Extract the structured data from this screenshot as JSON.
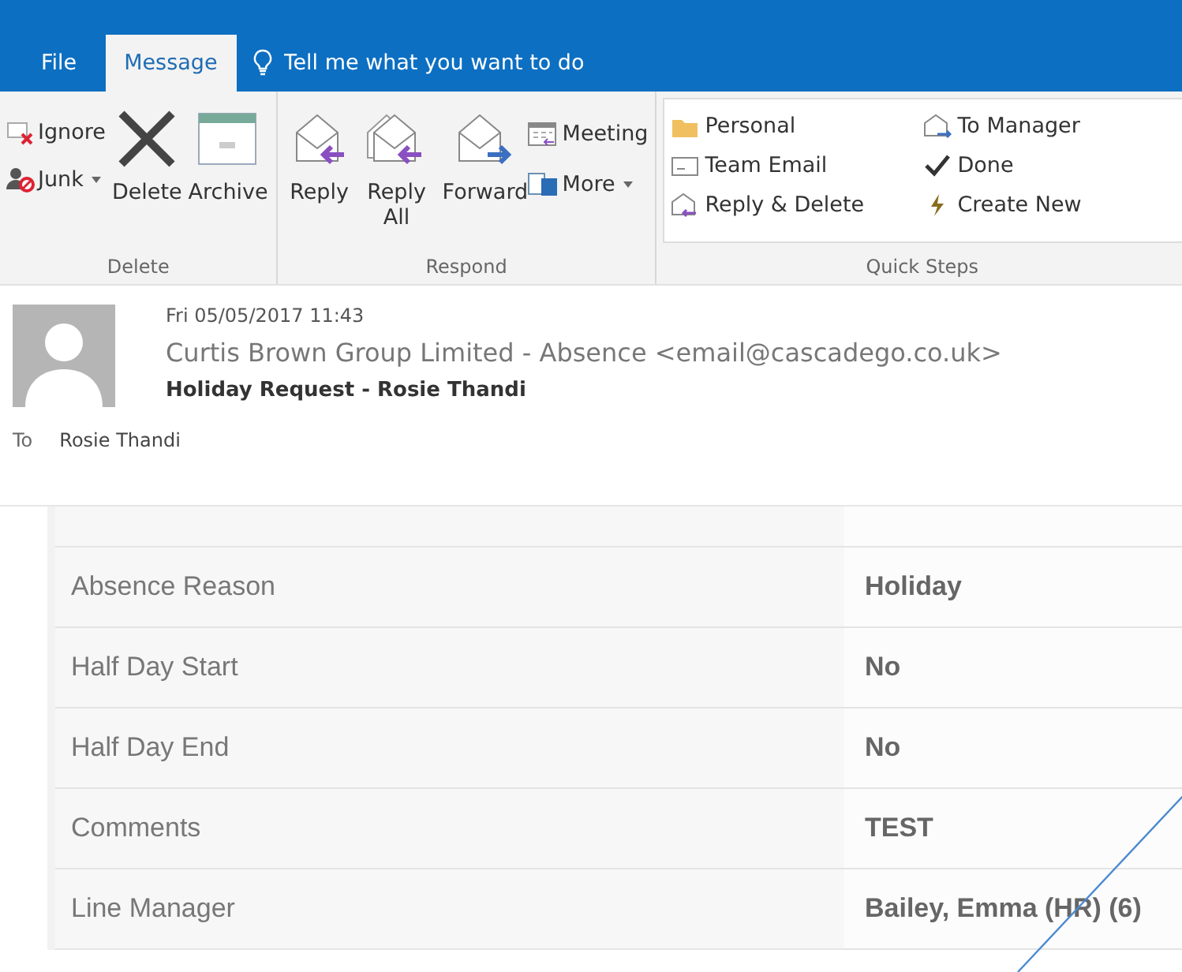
{
  "tabs": [
    {
      "label": "File",
      "selected": false
    },
    {
      "label": "Message",
      "selected": true
    }
  ],
  "tell_me": {
    "placeholder": "Tell me what you want to do"
  },
  "ribbon": {
    "groups": [
      {
        "label": "Delete",
        "small": [
          {
            "label": "Ignore",
            "kind": "ignore"
          },
          {
            "label": "Junk",
            "kind": "junk",
            "dropdown": true
          }
        ],
        "large": [
          {
            "label": "Delete",
            "kind": "delete"
          },
          {
            "label": "Archive",
            "kind": "archive"
          }
        ]
      },
      {
        "label": "Respond",
        "large": [
          {
            "label": "Reply",
            "kind": "reply"
          },
          {
            "label": "Reply All",
            "kind": "reply-all"
          },
          {
            "label": "Forward",
            "kind": "forward"
          }
        ],
        "small": [
          {
            "label": "Meeting",
            "kind": "meeting"
          },
          {
            "label": "More",
            "kind": "more",
            "dropdown": true
          }
        ]
      }
    ],
    "quick_steps": {
      "label": "Quick Steps",
      "items": [
        {
          "label": "Personal",
          "kind": "folder"
        },
        {
          "label": "To Manager",
          "kind": "mail-forward"
        },
        {
          "label": "Team Email",
          "kind": "team"
        },
        {
          "label": "Done",
          "kind": "check"
        },
        {
          "label": "Reply & Delete",
          "kind": "mail-reply"
        },
        {
          "label": "Create New",
          "kind": "bolt"
        }
      ]
    }
  },
  "message": {
    "date": "Fri 05/05/2017 11:43",
    "sender": "Curtis Brown Group Limited - Absence <email@cascadego.co.uk>",
    "subject": "Holiday Request - Rosie Thandi",
    "to_label": "To",
    "to": "Rosie Thandi"
  },
  "table": {
    "rows": [
      {
        "label": "Absence Reason",
        "value": "Holiday"
      },
      {
        "label": "Half Day Start",
        "value": "No"
      },
      {
        "label": "Half Day End",
        "value": "No"
      },
      {
        "label": "Comments",
        "value": "TEST"
      },
      {
        "label": "Line Manager",
        "value": "Bailey, Emma (HR) (6)"
      }
    ]
  }
}
